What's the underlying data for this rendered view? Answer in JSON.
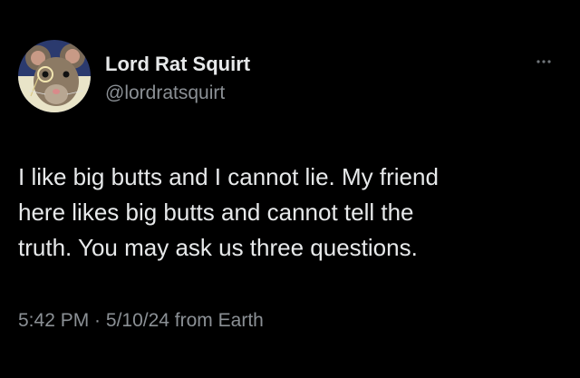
{
  "user": {
    "display_name": "Lord Rat Squirt",
    "handle": "@lordratsquirt",
    "avatar_icon": "rat-with-monocle-avatar"
  },
  "tweet": {
    "lines": [
      "I like big butts and I cannot lie. My friend",
      "here likes big butts and cannot tell the",
      "truth. You may ask us three questions."
    ]
  },
  "meta": {
    "time": "5:42 PM",
    "separator": " · ",
    "date": "5/10/24",
    "source": " from Earth"
  },
  "icons": {
    "more": "more-options-icon"
  },
  "colors": {
    "background": "#000000",
    "primary_text": "#e7e9ea",
    "secondary_text": "#8b9095"
  }
}
